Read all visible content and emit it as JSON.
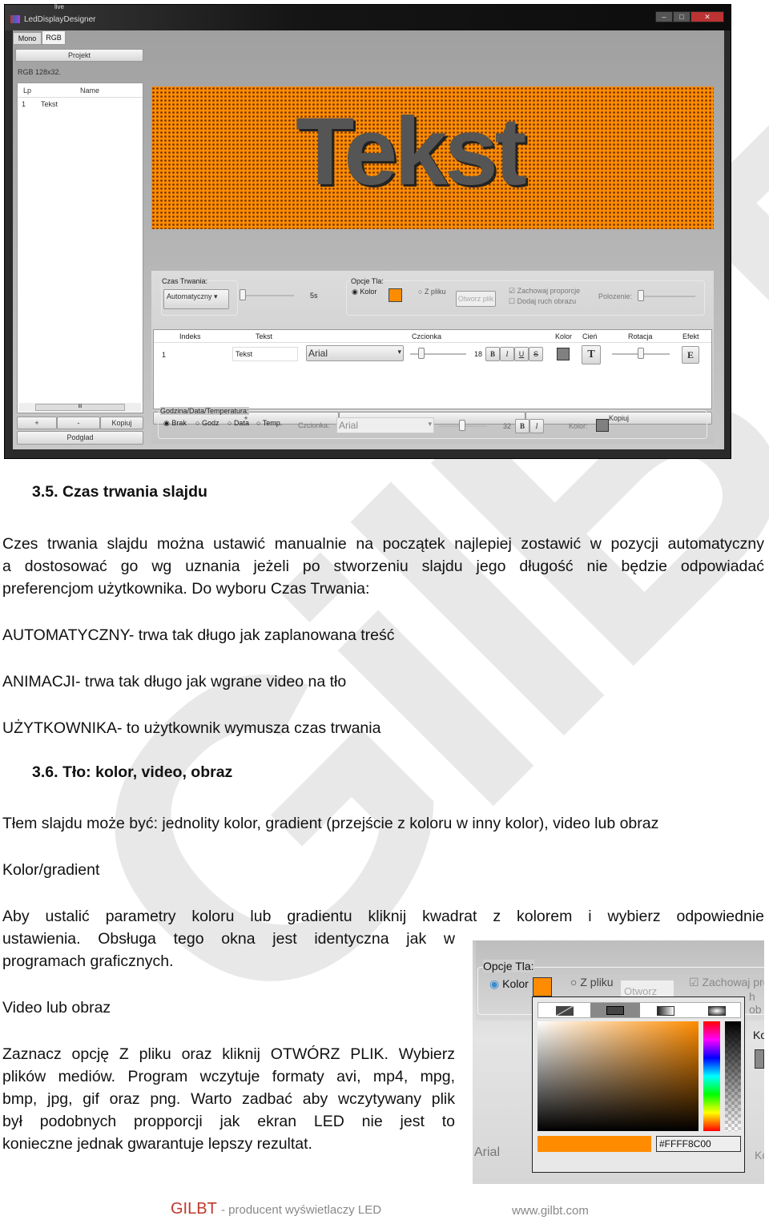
{
  "watermark": "GilBT",
  "app": {
    "title": "LedDisplayDesigner",
    "taskbar_text": "live",
    "tabs": [
      "Mono",
      "RGB"
    ],
    "projekt_button": "Projekt",
    "project_info": "RGB 128x32.",
    "list": {
      "headers": [
        "Lp",
        "Name"
      ],
      "rows": [
        {
          "lp": "1",
          "name": "Tekst"
        }
      ]
    },
    "scroll_thumb": "III",
    "left_buttons": [
      "+",
      "-",
      "Kopiuj"
    ],
    "podglad_button": "Podglad",
    "preview_text": "Tekst",
    "preview_bg": "#FF8C00",
    "czas": {
      "label": "Czas Trwania:",
      "select": "Automatyczny",
      "value": "5s"
    },
    "opcje": {
      "label": "Opcje Tla:",
      "kolor": "Kolor",
      "zpliku": "Z pliku",
      "otworz": "Otworz plik",
      "zachowaj": "Zachowaj proporcje",
      "dodaj": "Dodaj ruch obrazu",
      "polozenie": "Polozenie:"
    },
    "grid": {
      "headers": [
        "Indeks",
        "Tekst",
        "Czcionka",
        "Kolor",
        "Cień",
        "Rotacja",
        "Efekt"
      ],
      "row": {
        "indeks": "1",
        "tekst": "Tekst",
        "font": "Arial",
        "size": "18",
        "bold": "B",
        "italic": "I",
        "underline": "U",
        "strike": "S",
        "shadow": "T",
        "effect": "E"
      }
    },
    "grid_buttons": [
      "+",
      "-",
      "Kopiuj"
    ],
    "gdt": {
      "label": "Godzina/Data/Temperatura:",
      "options": [
        "Brak",
        "Godz",
        "Data",
        "Temp."
      ],
      "czcionka": "Czcionka:",
      "font": "Arial",
      "size": "32",
      "bold": "B",
      "italic": "I",
      "kolor": "Kolor:"
    }
  },
  "doc": {
    "h35": "3.5.  Czas trwania slajdu",
    "p1": [
      "Czes trwania slajdu można ustawić manualnie na początek najlepiej zostawić w pozycji automatyczny",
      "a dostosować go wg uznania jeżeli po stworzeniu slajdu jego długość nie będzie odpowiadać",
      "preferencjom użytkownika. Do wyboru Czas Trwania:"
    ],
    "l1": "AUTOMATYCZNY- trwa tak długo jak zaplanowana treść",
    "l2": "ANIMACJI- trwa tak długo jak wgrane video na tło",
    "l3": "UŻYTKOWNIKA- to użytkownik wymusza czas trwania",
    "h36": "3.6.  Tło: kolor, video, obraz",
    "p2": "Tłem slajdu może być: jednolity kolor, gradient (przejście z koloru w inny kolor), video lub obraz",
    "s1": "Kolor/gradient",
    "p3": [
      "Aby ustalić parametry koloru lub gradientu kliknij kwadrat z kolorem i wybierz odpowiednie",
      "ustawienia. Obsługa tego okna jest identyczna jak w",
      "programach graficznych."
    ],
    "s2": "Video lub obraz",
    "p4": [
      "Zaznacz opcję Z pliku  oraz kliknij OTWÓRZ PLIK. Wybierz",
      "plików mediów. Program wczytuje formaty avi, mp4, mpg,",
      "bmp, jpg, gif oraz png. Warto zadbać aby wczytywany plik",
      "był podobnych propporcji jak ekran LED nie jest to",
      "konieczne jednak gwarantuje lepszy rezultat."
    ]
  },
  "picker": {
    "opcje": "Opcje Tla:",
    "kolor": "Kolor",
    "zpliku": "Z pliku",
    "otworz": "Otworz plik",
    "zachowaj": "Zachowaj pro",
    "dodaj": "h ob",
    "ko": "Ko",
    "arial": "Arial",
    "hex": "#FFFF8C00",
    "color": "#FF8C00"
  },
  "footer": {
    "logo": "GILBT",
    "tagline": "- producent wyświetlaczy LED",
    "url": "www.gilbt.com"
  }
}
